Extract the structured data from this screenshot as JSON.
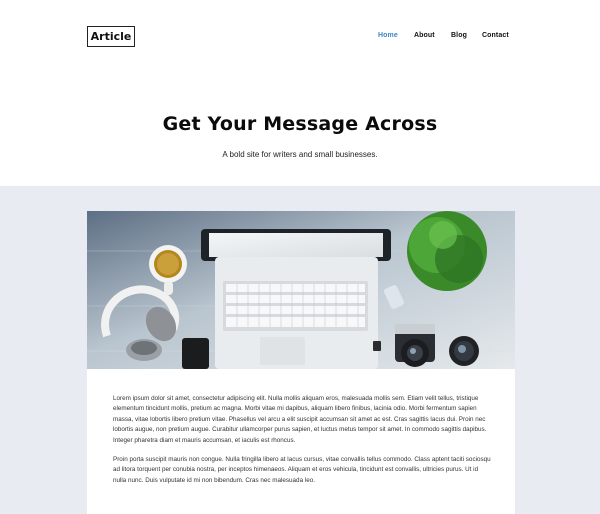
{
  "header": {
    "logo": "Article",
    "nav": [
      {
        "label": "Home",
        "active": true
      },
      {
        "label": "About",
        "active": false
      },
      {
        "label": "Blog",
        "active": false
      },
      {
        "label": "Contact",
        "active": false
      }
    ]
  },
  "hero": {
    "title": "Get Your Message Across",
    "subtitle": "A bold site for writers and small businesses."
  },
  "article": {
    "image_alt_icon": "workspace-photo",
    "paragraphs": [
      "Lorem ipsum dolor sit amet, consectetur adipiscing elit. Nulla mollis aliquam eros, malesuada mollis sem. Etiam velit tellus, tristique elementum tincidunt mollis, pretium ac magna. Morbi vitae mi dapibus, aliquam libero finibus, lacinia odio. Morbi fermentum sapien massa, vitae lobortis libero pretium vitae. Phasellus vel arcu a elit suscipit accumsan sit amet ac est. Cras sagittis lacus dui. Proin nec lobortis augue, non pretium augue. Curabitur ullamcorper purus sapien, et luctus metus tempor sit amet. In commodo sagittis dapibus. Integer pharetra diam et mauris accumsan, et iaculis est rhoncus.",
      "Proin porta suscipit mauris non congue. Nulla fringilla libero at lacus cursus, vitae convallis tellus commodo. Class aptent taciti sociosqu ad litora torquent per conubia nostra, per inceptos himenaeos. Aliquam et eros vehicula, tincidunt est convallis, ultricies purus. Ut id nulla nunc. Duis vulputate id mi non bibendum. Cras nec malesuada leo."
    ]
  },
  "colors": {
    "accent": "#3a86c8",
    "band": "#e8ebf1"
  }
}
